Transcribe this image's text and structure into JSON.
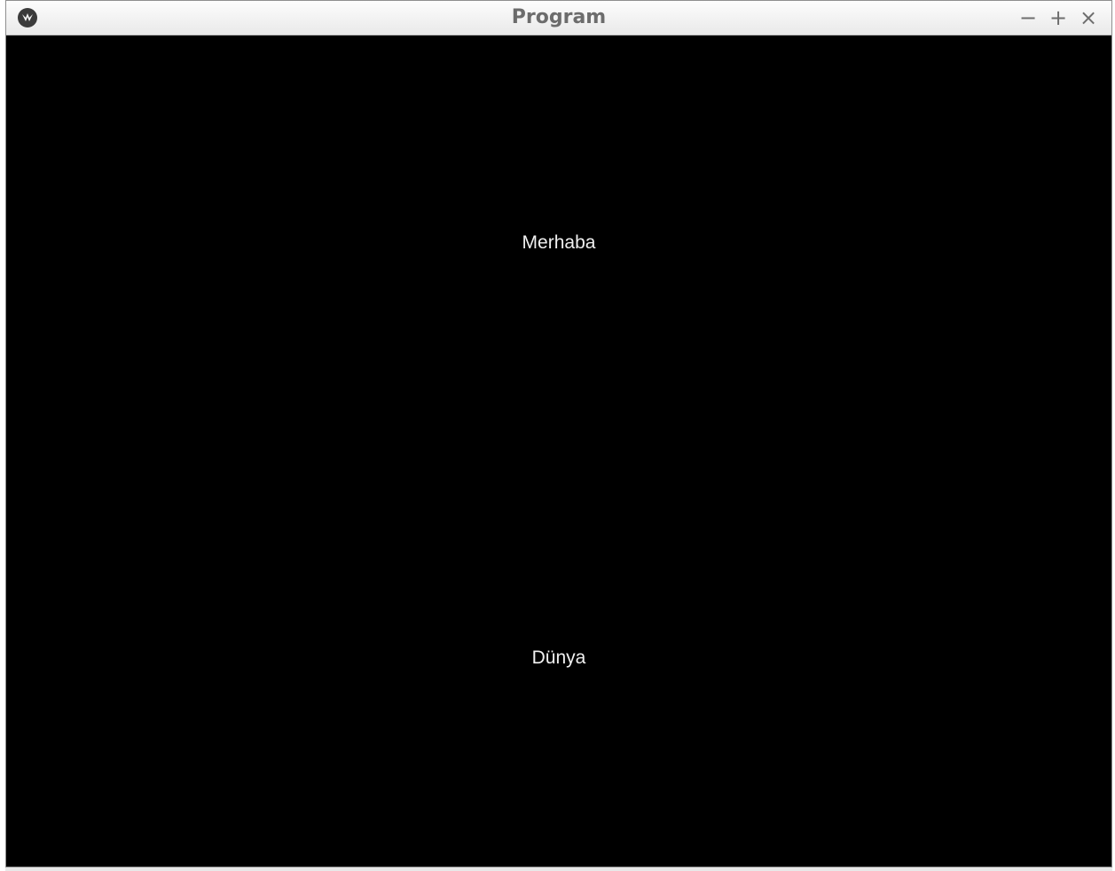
{
  "window": {
    "title": "Program",
    "app_icon": "kivy-logo-icon",
    "controls": {
      "minimize": "−",
      "maximize": "+",
      "close": "×"
    }
  },
  "content": {
    "labels": [
      "Merhaba",
      "Dünya"
    ],
    "background": "#000000",
    "text_color": "#f0f0f0"
  }
}
